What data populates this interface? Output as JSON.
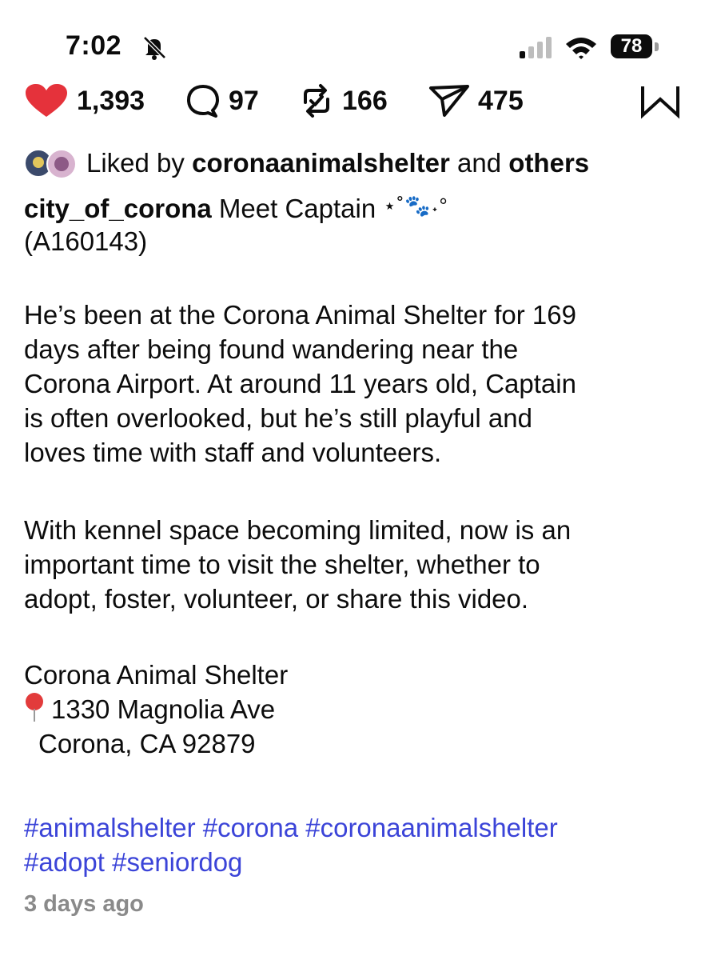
{
  "status_bar": {
    "time": "7:02",
    "battery": "78"
  },
  "actions": {
    "likes": "1,393",
    "comments": "97",
    "reposts": "166",
    "shares": "475"
  },
  "liked_by": {
    "prefix": "Liked by ",
    "user": "coronaanimalshelter",
    "middle": " and ",
    "others": "others"
  },
  "post": {
    "username": "city_of_corona",
    "caption_start": " Meet Captain ",
    "caption_deco": "⋆˚🐾˖°",
    "caption_id": "(A160143)",
    "paragraph1": [
      "He’s been at the Corona Animal Shelter for 169",
      "days after being found wandering near the",
      "Corona Airport. At around 11 years old, Captain",
      "is often overlooked, but he’s still playful and",
      "loves time with staff and volunteers."
    ],
    "paragraph2": [
      "With kennel space becoming limited, now is an",
      "important time to visit the shelter, whether to",
      "adopt, foster, volunteer, or share this video."
    ],
    "shelter_name": "Corona Animal Shelter",
    "address_line1": "1330 Magnolia Ave",
    "address_line2": "Corona, CA 92879",
    "hashtags_line1": [
      "#animalshelter",
      "#corona",
      "#coronaanimalshelter"
    ],
    "hashtags_line2": [
      "#adopt",
      "#seniordog"
    ],
    "posted": "3 days ago"
  },
  "icons": [
    "bell-slash-icon",
    "cellular-signal-icon",
    "wifi-icon",
    "battery-icon",
    "heart-icon",
    "comment-icon",
    "repost-icon",
    "share-icon",
    "threads-w-icon",
    "location-pin-icon"
  ],
  "colors": {
    "heart": "#e5323b",
    "hashtag": "#3b44d8",
    "muted": "#8a8a8a"
  }
}
